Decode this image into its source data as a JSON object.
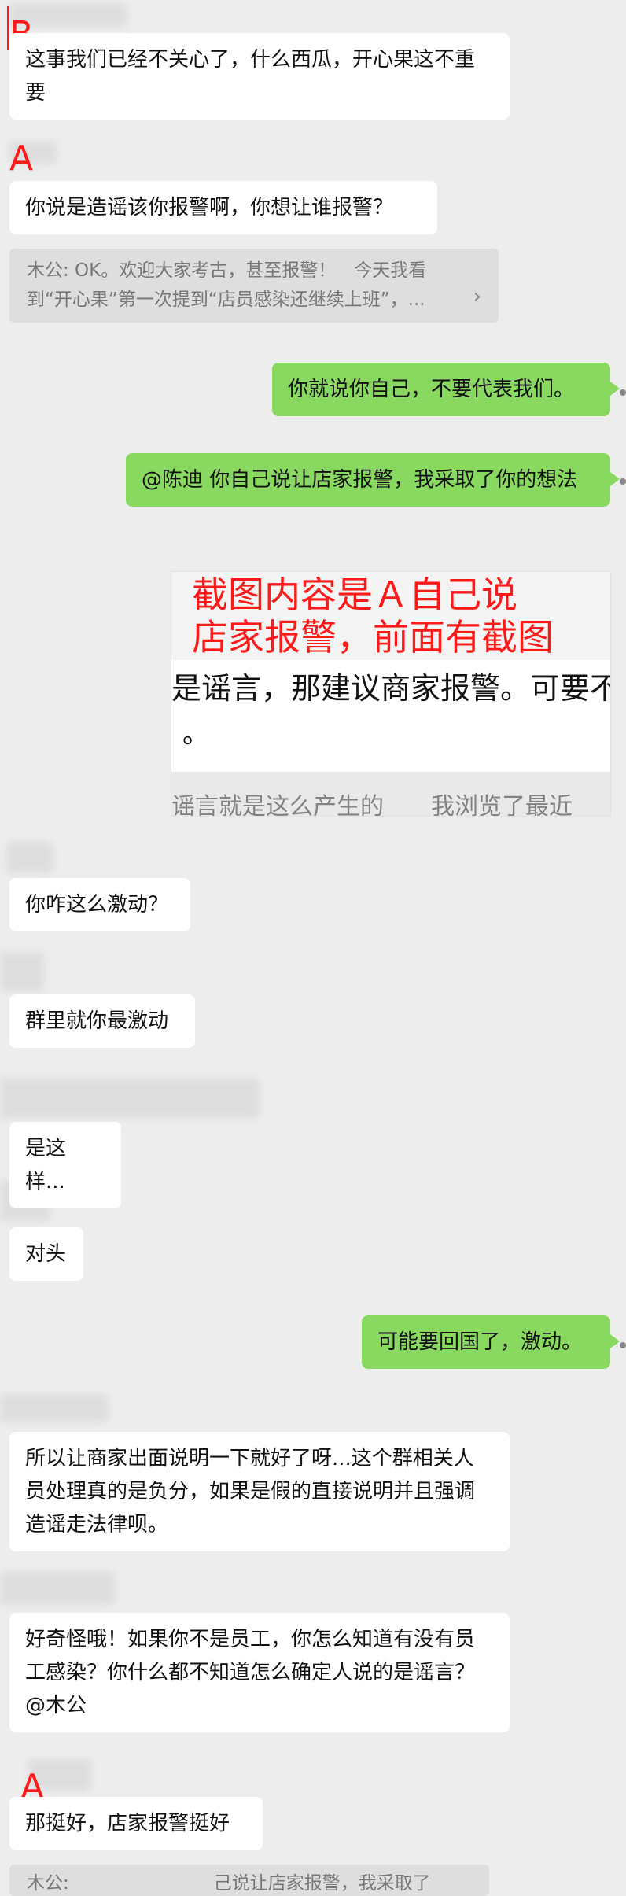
{
  "labels": {
    "b_top": "B",
    "a_second": "A",
    "a_bottom": "A"
  },
  "colors": {
    "background": "#ededed",
    "incoming_bubble": "#ffffff",
    "outgoing_bubble": "#89d961",
    "annotation_red": "#ff1a1a"
  },
  "messages": [
    {
      "direction": "in",
      "text": "这事我们已经不关心了，什么西瓜，开心果这不重要"
    },
    {
      "direction": "in",
      "text": "你说是造谣该你报警啊，你想让谁报警？"
    },
    {
      "direction": "out",
      "text": "你就说你自己，不要代表我们。"
    },
    {
      "direction": "out",
      "text": "@陈迪 你自己说让店家报警，我采取了你的想法"
    },
    {
      "direction": "in",
      "text": "你咋这么激动？"
    },
    {
      "direction": "in",
      "text": "群里就你最激动"
    },
    {
      "direction": "in",
      "text": "是这样..."
    },
    {
      "direction": "in",
      "text": "对头"
    },
    {
      "direction": "out",
      "text": "可能要回国了，激动。"
    },
    {
      "direction": "in",
      "text": "所以让商家出面说明一下就好了呀...这个群相关人员处理真的是负分，如果是假的直接说明并且强调造谣走法律呗。"
    },
    {
      "direction": "in",
      "text": "好奇怪哦！如果你不是员工，你怎么知道有没有员工感染？你什么都不知道怎么确定人说的是谣言？@木公"
    },
    {
      "direction": "in",
      "text": "那挺好，店家报警挺好"
    }
  ],
  "quote": {
    "text": "木公: OK。欢迎大家考古，甚至报警！　今天我看到“开心果”第一次提到“店员感染还继续上班”，...",
    "chevron": "›",
    "partial_bottom": "木公:　　　　　　　　己说让店家报警，我采取了你的想"
  },
  "screenshot": {
    "caption": "截图内容是Ａ自己说\n店家报警，前面有截图",
    "line1": "是谣言，那建议商家报警。可要不",
    "line2": "。",
    "line3": "谣言就是这么产生的　　我浏览了最近"
  }
}
